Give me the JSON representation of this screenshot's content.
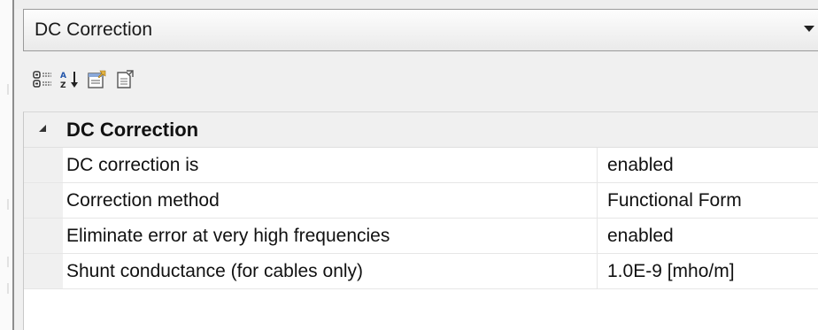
{
  "object_selector": {
    "selected": "DC Correction"
  },
  "toolbar": {
    "buttons": [
      {
        "icon": "categorized-icon"
      },
      {
        "icon": "alphabetical-sort-icon"
      },
      {
        "icon": "property-pages-icon"
      },
      {
        "icon": "events-icon"
      }
    ]
  },
  "property_grid": {
    "category": {
      "label": "DC Correction",
      "expanded": true
    },
    "properties": [
      {
        "name": "DC correction is",
        "value": "enabled"
      },
      {
        "name": "Correction method",
        "value": "Functional Form"
      },
      {
        "name": "Eliminate error at very high frequencies",
        "value": "enabled"
      },
      {
        "name": "Shunt conductance (for cables only)",
        "value": "1.0E-9 [mho/m]"
      }
    ]
  }
}
